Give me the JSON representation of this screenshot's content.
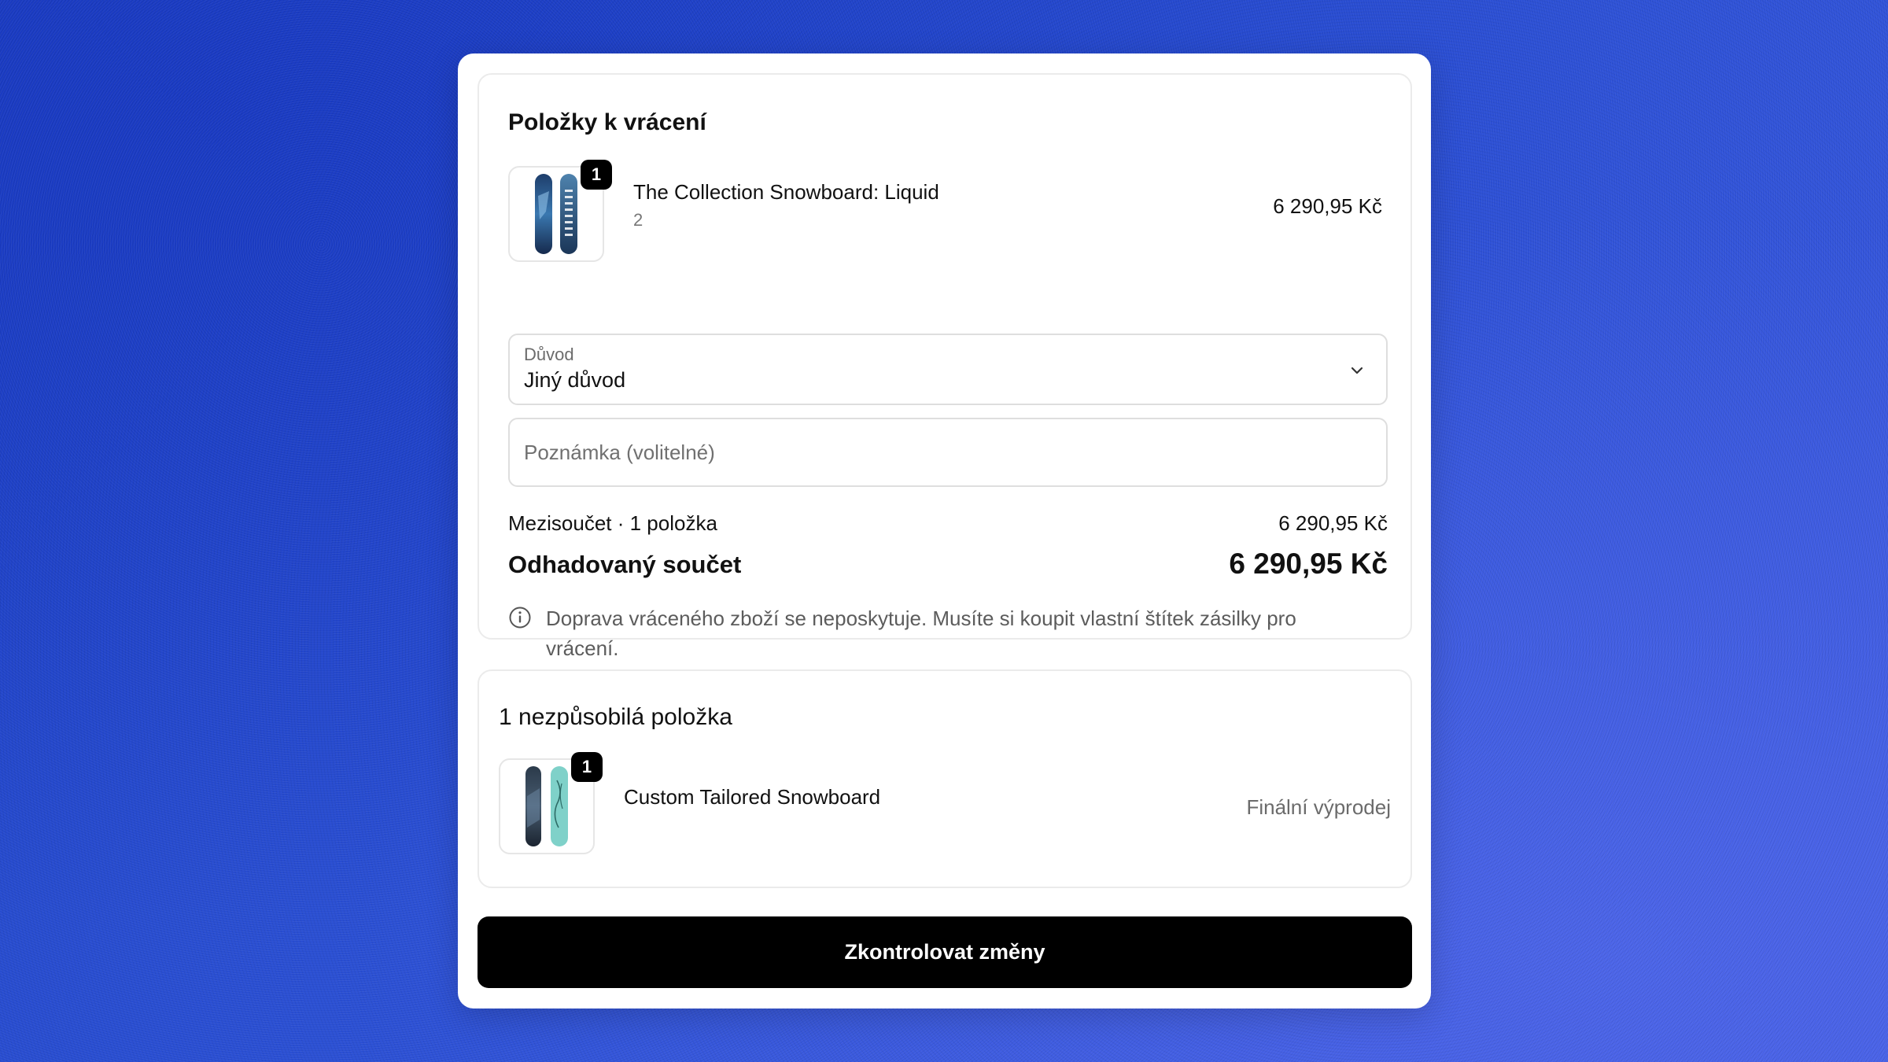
{
  "return_items": {
    "title": "Položky k vrácení",
    "product": {
      "quantity_badge": "1",
      "name": "The Collection Snowboard: Liquid",
      "subtext": "2",
      "price": "6 290,95 Kč",
      "icon": "snowboard-image"
    },
    "reason": {
      "label": "Důvod",
      "value": "Jiný důvod",
      "icon": "chevron-down-icon"
    },
    "note": {
      "placeholder": "Poznámka (volitelné)",
      "value": ""
    },
    "subtotal": {
      "label": "Mezisoučet · 1 položka",
      "value": "6 290,95 Kč"
    },
    "total": {
      "label": "Odhadovaný součet",
      "value": "6 290,95 Kč"
    },
    "info": {
      "icon": "info-icon",
      "text": "Doprava vráceného zboží se neposkytuje. Musíte si koupit vlastní štítek zásilky pro vrácení."
    }
  },
  "ineligible": {
    "title": "1 nezpůsobilá položka",
    "product": {
      "quantity_badge": "1",
      "name": "Custom Tailored Snowboard",
      "status": "Finální výprodej",
      "icon": "snowboard-image"
    }
  },
  "cta": {
    "label": "Zkontrolovat změny"
  },
  "colors": {
    "background": "#2a4fd3",
    "button": "#000000",
    "card_border": "#ebebeb"
  }
}
